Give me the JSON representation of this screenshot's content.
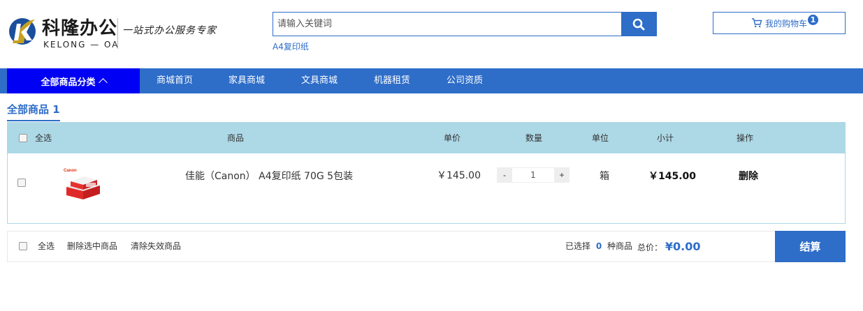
{
  "header": {
    "logo": {
      "name_cn": "科隆办公",
      "name_en": "KELONG — OA",
      "slogan": "一站式办公服务专家"
    },
    "search": {
      "placeholder": "请输入关键词",
      "hot_words": [
        "A4复印纸"
      ]
    },
    "cart": {
      "label": "我的购物车",
      "count": "1"
    }
  },
  "nav": {
    "all_categories": "全部商品分类",
    "items": [
      "商城首页",
      "家具商城",
      "文具商城",
      "机器租赁",
      "公司资质"
    ]
  },
  "cart_tab": {
    "label": "全部商品 1"
  },
  "table": {
    "headers": {
      "select_all": "全选",
      "product": "商品",
      "unit_price": "单价",
      "quantity": "数量",
      "unit": "单位",
      "subtotal": "小计",
      "action": "操作"
    },
    "rows": [
      {
        "name": "佳能（Canon） A4复印纸 70G 5包装",
        "unit_price": "￥145.00",
        "quantity": "1",
        "unit": "箱",
        "subtotal": "￥145.00",
        "action": "删除",
        "minus": "-",
        "plus": "+",
        "image_brand": "Canon"
      }
    ]
  },
  "footer": {
    "select_all": "全选",
    "delete_selected": "删除选中商品",
    "clear_invalid": "清除失效商品",
    "selected_prefix": "已选择",
    "selected_count": "0",
    "selected_suffix": "种商品",
    "total_label": "总价：",
    "total_value": "¥0.00",
    "checkout": "结算"
  },
  "colors": {
    "primary": "#2e6dc8",
    "nav_all": "#0000f5",
    "table_header": "#add8e6"
  },
  "icons": {
    "search": "search-icon",
    "cart": "cart-icon",
    "chevron": "chevron-up-icon"
  }
}
